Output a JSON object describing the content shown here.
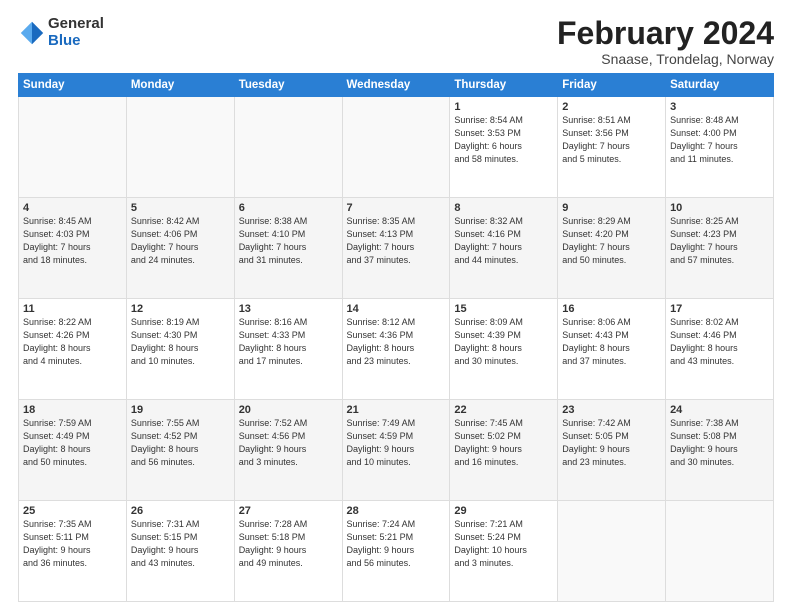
{
  "logo": {
    "general": "General",
    "blue": "Blue"
  },
  "title": {
    "month": "February 2024",
    "location": "Snaase, Trondelag, Norway"
  },
  "weekdays": [
    "Sunday",
    "Monday",
    "Tuesday",
    "Wednesday",
    "Thursday",
    "Friday",
    "Saturday"
  ],
  "weeks": [
    [
      {
        "day": "",
        "info": ""
      },
      {
        "day": "",
        "info": ""
      },
      {
        "day": "",
        "info": ""
      },
      {
        "day": "",
        "info": ""
      },
      {
        "day": "1",
        "info": "Sunrise: 8:54 AM\nSunset: 3:53 PM\nDaylight: 6 hours\nand 58 minutes."
      },
      {
        "day": "2",
        "info": "Sunrise: 8:51 AM\nSunset: 3:56 PM\nDaylight: 7 hours\nand 5 minutes."
      },
      {
        "day": "3",
        "info": "Sunrise: 8:48 AM\nSunset: 4:00 PM\nDaylight: 7 hours\nand 11 minutes."
      }
    ],
    [
      {
        "day": "4",
        "info": "Sunrise: 8:45 AM\nSunset: 4:03 PM\nDaylight: 7 hours\nand 18 minutes."
      },
      {
        "day": "5",
        "info": "Sunrise: 8:42 AM\nSunset: 4:06 PM\nDaylight: 7 hours\nand 24 minutes."
      },
      {
        "day": "6",
        "info": "Sunrise: 8:38 AM\nSunset: 4:10 PM\nDaylight: 7 hours\nand 31 minutes."
      },
      {
        "day": "7",
        "info": "Sunrise: 8:35 AM\nSunset: 4:13 PM\nDaylight: 7 hours\nand 37 minutes."
      },
      {
        "day": "8",
        "info": "Sunrise: 8:32 AM\nSunset: 4:16 PM\nDaylight: 7 hours\nand 44 minutes."
      },
      {
        "day": "9",
        "info": "Sunrise: 8:29 AM\nSunset: 4:20 PM\nDaylight: 7 hours\nand 50 minutes."
      },
      {
        "day": "10",
        "info": "Sunrise: 8:25 AM\nSunset: 4:23 PM\nDaylight: 7 hours\nand 57 minutes."
      }
    ],
    [
      {
        "day": "11",
        "info": "Sunrise: 8:22 AM\nSunset: 4:26 PM\nDaylight: 8 hours\nand 4 minutes."
      },
      {
        "day": "12",
        "info": "Sunrise: 8:19 AM\nSunset: 4:30 PM\nDaylight: 8 hours\nand 10 minutes."
      },
      {
        "day": "13",
        "info": "Sunrise: 8:16 AM\nSunset: 4:33 PM\nDaylight: 8 hours\nand 17 minutes."
      },
      {
        "day": "14",
        "info": "Sunrise: 8:12 AM\nSunset: 4:36 PM\nDaylight: 8 hours\nand 23 minutes."
      },
      {
        "day": "15",
        "info": "Sunrise: 8:09 AM\nSunset: 4:39 PM\nDaylight: 8 hours\nand 30 minutes."
      },
      {
        "day": "16",
        "info": "Sunrise: 8:06 AM\nSunset: 4:43 PM\nDaylight: 8 hours\nand 37 minutes."
      },
      {
        "day": "17",
        "info": "Sunrise: 8:02 AM\nSunset: 4:46 PM\nDaylight: 8 hours\nand 43 minutes."
      }
    ],
    [
      {
        "day": "18",
        "info": "Sunrise: 7:59 AM\nSunset: 4:49 PM\nDaylight: 8 hours\nand 50 minutes."
      },
      {
        "day": "19",
        "info": "Sunrise: 7:55 AM\nSunset: 4:52 PM\nDaylight: 8 hours\nand 56 minutes."
      },
      {
        "day": "20",
        "info": "Sunrise: 7:52 AM\nSunset: 4:56 PM\nDaylight: 9 hours\nand 3 minutes."
      },
      {
        "day": "21",
        "info": "Sunrise: 7:49 AM\nSunset: 4:59 PM\nDaylight: 9 hours\nand 10 minutes."
      },
      {
        "day": "22",
        "info": "Sunrise: 7:45 AM\nSunset: 5:02 PM\nDaylight: 9 hours\nand 16 minutes."
      },
      {
        "day": "23",
        "info": "Sunrise: 7:42 AM\nSunset: 5:05 PM\nDaylight: 9 hours\nand 23 minutes."
      },
      {
        "day": "24",
        "info": "Sunrise: 7:38 AM\nSunset: 5:08 PM\nDaylight: 9 hours\nand 30 minutes."
      }
    ],
    [
      {
        "day": "25",
        "info": "Sunrise: 7:35 AM\nSunset: 5:11 PM\nDaylight: 9 hours\nand 36 minutes."
      },
      {
        "day": "26",
        "info": "Sunrise: 7:31 AM\nSunset: 5:15 PM\nDaylight: 9 hours\nand 43 minutes."
      },
      {
        "day": "27",
        "info": "Sunrise: 7:28 AM\nSunset: 5:18 PM\nDaylight: 9 hours\nand 49 minutes."
      },
      {
        "day": "28",
        "info": "Sunrise: 7:24 AM\nSunset: 5:21 PM\nDaylight: 9 hours\nand 56 minutes."
      },
      {
        "day": "29",
        "info": "Sunrise: 7:21 AM\nSunset: 5:24 PM\nDaylight: 10 hours\nand 3 minutes."
      },
      {
        "day": "",
        "info": ""
      },
      {
        "day": "",
        "info": ""
      }
    ]
  ]
}
